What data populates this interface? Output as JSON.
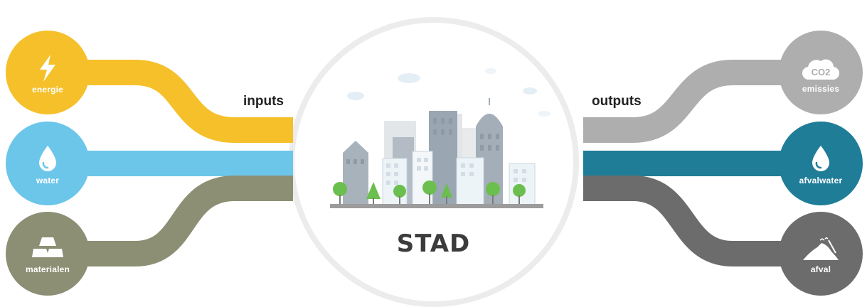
{
  "inputs_label": "inputs",
  "outputs_label": "outputs",
  "center_label": "STAD",
  "inputs": [
    {
      "label": "energie",
      "color": "#f5c02a",
      "icon": "lightning-icon"
    },
    {
      "label": "water",
      "color": "#6cc6ea",
      "icon": "water-drop-icon"
    },
    {
      "label": "materialen",
      "color": "#8c8f74",
      "icon": "material-bars-icon"
    }
  ],
  "outputs": [
    {
      "label": "emissies",
      "icon_text": "CO2",
      "color": "#aeaeae",
      "icon": "co2-cloud-icon"
    },
    {
      "label": "afvalwater",
      "color": "#1f7d98",
      "icon": "water-drop-icon"
    },
    {
      "label": "afval",
      "color": "#6c6c6c",
      "icon": "waste-heap-icon"
    }
  ]
}
